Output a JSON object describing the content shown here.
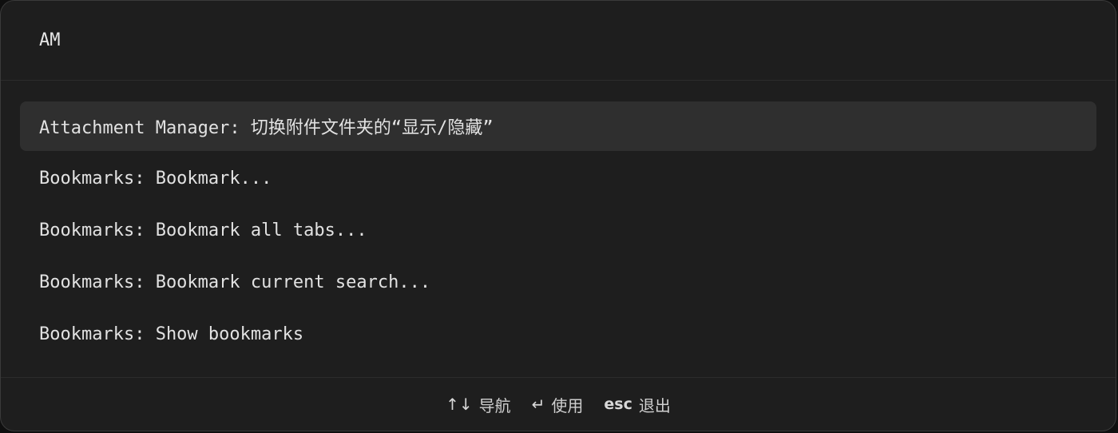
{
  "search": {
    "value": "AM"
  },
  "results": [
    {
      "label": "Attachment Manager: 切换附件文件夹的“显示/隐藏”",
      "selected": true
    },
    {
      "label": "Bookmarks: Bookmark...",
      "selected": false
    },
    {
      "label": "Bookmarks: Bookmark all tabs...",
      "selected": false
    },
    {
      "label": "Bookmarks: Bookmark current search...",
      "selected": false
    },
    {
      "label": "Bookmarks: Show bookmarks",
      "selected": false
    }
  ],
  "footer": {
    "navigate": {
      "key": "↑↓",
      "label": "导航"
    },
    "use": {
      "key": "↵",
      "label": "使用"
    },
    "exit": {
      "key": "esc",
      "label": "退出"
    }
  }
}
